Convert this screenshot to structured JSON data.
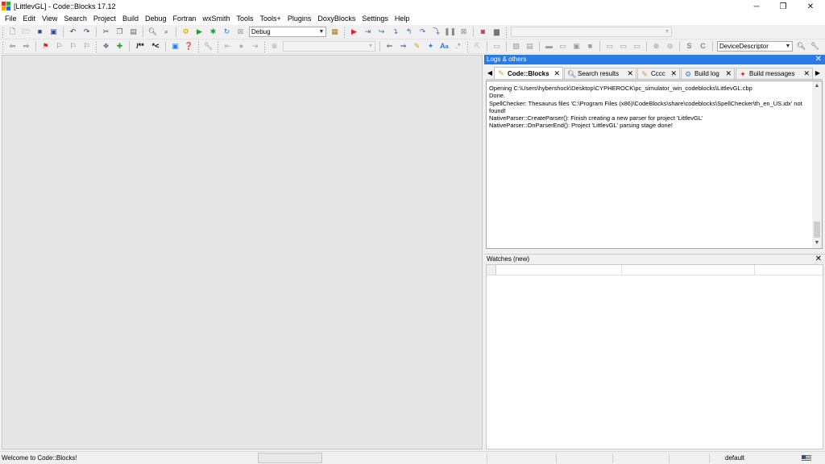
{
  "window": {
    "title": "[LittlevGL] - Code::Blocks 17.12",
    "controls": {
      "minimize": "─",
      "maximize": "❐",
      "close": "✕"
    }
  },
  "menu": [
    "File",
    "Edit",
    "View",
    "Search",
    "Project",
    "Build",
    "Debug",
    "Fortran",
    "wxSmith",
    "Tools",
    "Tools+",
    "Plugins",
    "DoxyBlocks",
    "Settings",
    "Help"
  ],
  "toolbar": {
    "build_target": "Debug",
    "code_completion_value": "DeviceDescriptor",
    "doxy_comment": "/**",
    "doxy_inline": "*<"
  },
  "logs_panel": {
    "title": "Logs & others",
    "tabs": [
      {
        "label": "Code::Blocks",
        "icon": "pencil-icon"
      },
      {
        "label": "Search results",
        "icon": "magnifier-icon"
      },
      {
        "label": "Cccc",
        "icon": "pencil-icon"
      },
      {
        "label": "Build log",
        "icon": "gear-icon"
      },
      {
        "label": "Build messages",
        "icon": "pin-icon"
      }
    ],
    "lines": [
      "Opening C:\\Users\\hybershock\\Desktop\\CYPHEROCK\\pc_simulator_win_codeblocks\\LittlevGL.cbp",
      "Done.",
      "SpellChecker: Thesaurus files 'C:\\Program Files (x86)\\CodeBlocks\\share\\codeblocks\\SpellChecker\\th_en_US.idx' not found!",
      "NativeParser::CreateParser(): Finish creating a new parser for project 'LittlevGL'",
      "NativeParser::OnParserEnd(): Project 'LittlevGL' parsing stage done!"
    ]
  },
  "watches_panel": {
    "title": "Watches (new)"
  },
  "statusbar": {
    "message": "Welcome to Code::Blocks!",
    "profile": "default"
  },
  "colors": {
    "accent": "#2a7be4"
  }
}
